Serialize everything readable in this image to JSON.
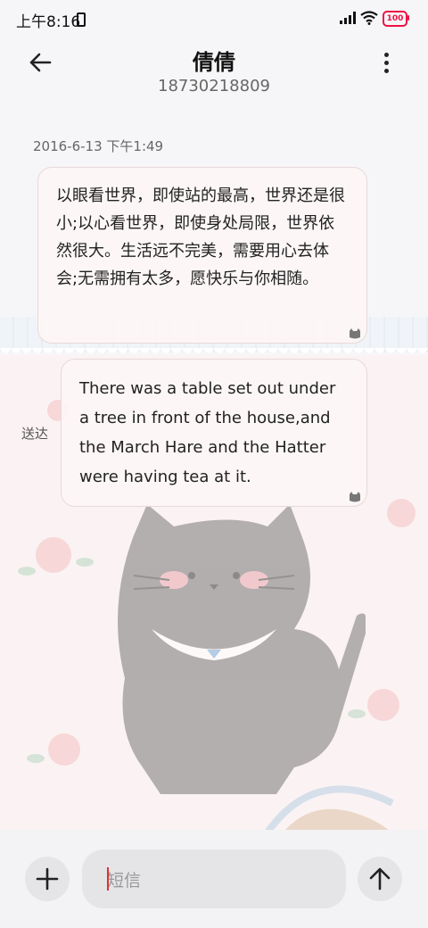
{
  "status_bar": {
    "time": "上午8:16",
    "battery": "100"
  },
  "header": {
    "contact_name": "倩倩",
    "phone_number": "18730218809"
  },
  "messages": [
    {
      "timestamp": "2016-6-13 下午1:49",
      "text": "以眼看世界，即使站的最高，世界还是很小;以心看世界，即使身处局限，世界依然很大。生活远不完美，需要用心去体会;无需拥有太多，愿快乐与你相随。"
    },
    {
      "text": "There was a table set out under a tree in front of the house,and the March Hare and the Hatter were having tea at it.",
      "status": "送达"
    }
  ],
  "composer": {
    "placeholder": "短信"
  },
  "colors": {
    "battery_red": "#ee1144",
    "bubble_bg": "#fcf5f5"
  },
  "icons": [
    "back-arrow-icon",
    "more-vertical-icon",
    "plus-icon",
    "send-arrow-icon",
    "signal-icon",
    "wifi-icon",
    "battery-icon",
    "vibrate-icon"
  ]
}
